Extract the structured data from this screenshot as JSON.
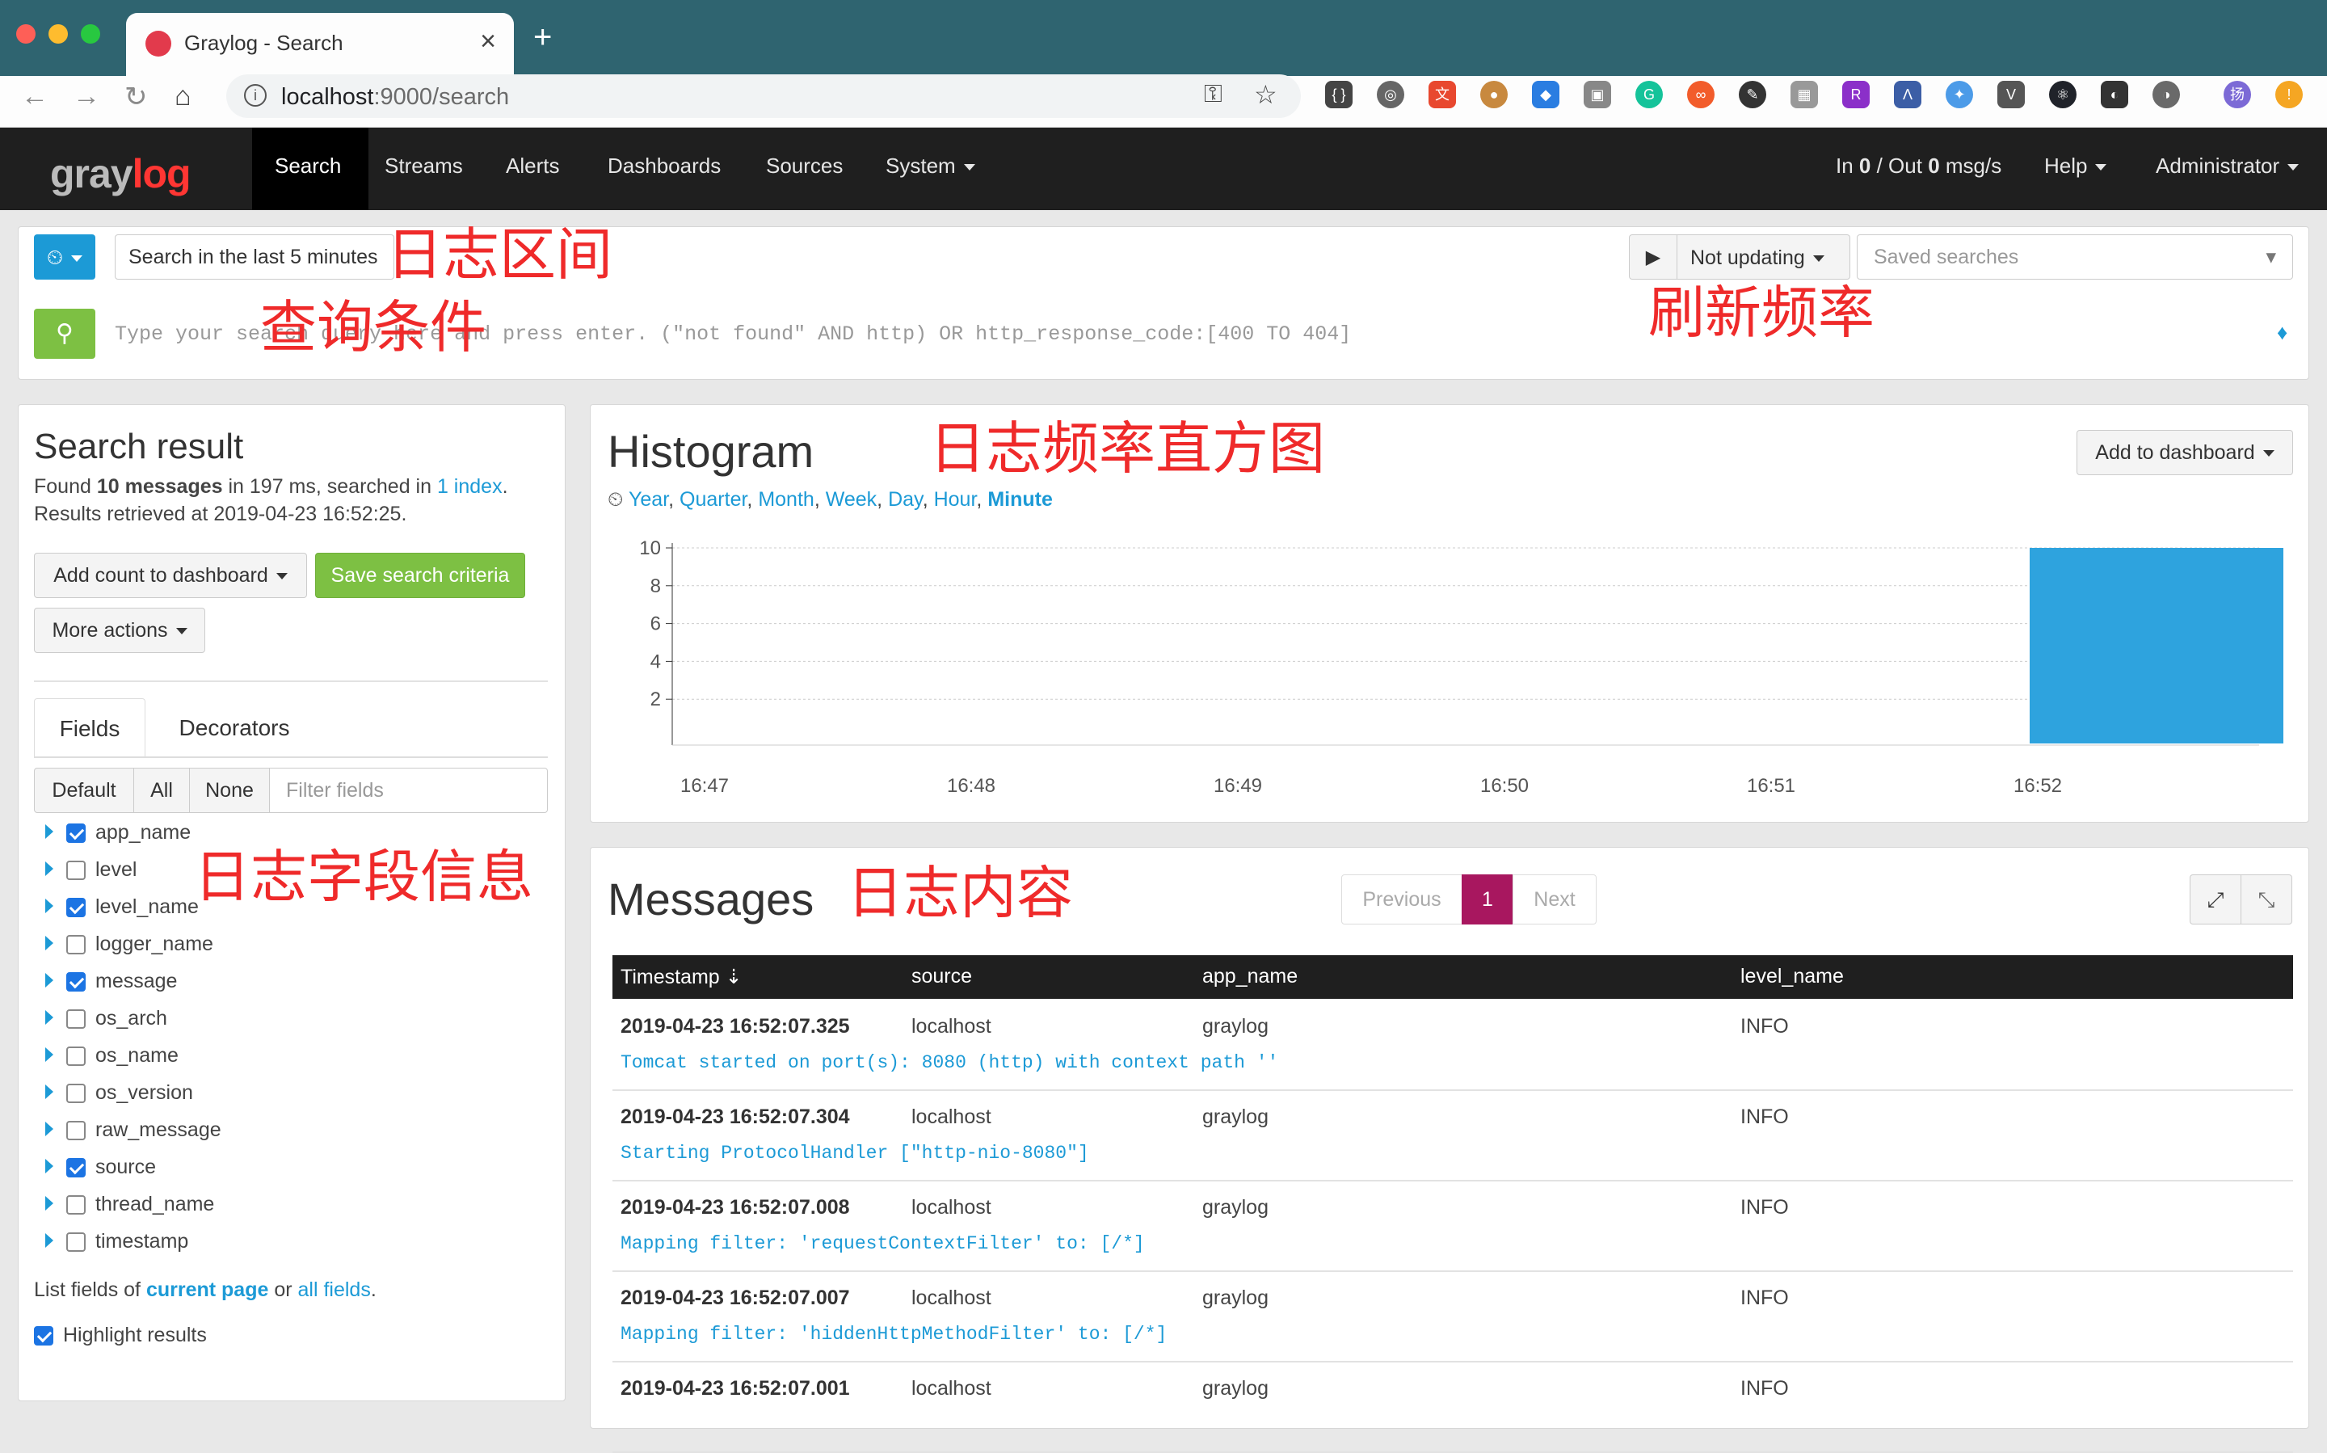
{
  "browser": {
    "tab_title": "Graylog - Search",
    "url_host": "localhost",
    "url_path": ":9000/search"
  },
  "nav": {
    "logo_gray": "gray",
    "logo_red": "log",
    "items": [
      "Search",
      "Streams",
      "Alerts",
      "Dashboards",
      "Sources",
      "System"
    ],
    "throughput_in_label": "In ",
    "throughput_in": "0",
    "throughput_sep": " / Out ",
    "throughput_out": "0",
    "throughput_unit": " msg/s",
    "help": "Help",
    "user": "Administrator"
  },
  "search_bar": {
    "range_text": "Search in the last 5 minutes",
    "query_placeholder": "Type your search query here and press enter. (\"not found\" AND http) OR http_response_code:[400 TO 404]",
    "refresh": "Not updating",
    "saved_searches": "Saved searches"
  },
  "annotations": {
    "range": "日志区间",
    "query": "查询条件",
    "refresh": "刷新频率",
    "histogram": "日志频率直方图",
    "fields": "日志字段信息",
    "messages": "日志内容"
  },
  "search_result": {
    "title": "Search result",
    "found_prefix": "Found ",
    "found_count": "10 messages",
    "found_mid": " in 197 ms, searched in ",
    "index_link": "1 index",
    "found_suffix": ".",
    "retrieved": "Results retrieved at 2019-04-23 16:52:25.",
    "add_count": "Add count to dashboard",
    "save_criteria": "Save search criteria",
    "more_actions": "More actions",
    "tab_fields": "Fields",
    "tab_decorators": "Decorators",
    "filter_default": "Default",
    "filter_all": "All",
    "filter_none": "None",
    "filter_placeholder": "Filter fields",
    "fields": [
      {
        "name": "app_name",
        "checked": true
      },
      {
        "name": "level",
        "checked": false
      },
      {
        "name": "level_name",
        "checked": true
      },
      {
        "name": "logger_name",
        "checked": false
      },
      {
        "name": "message",
        "checked": true
      },
      {
        "name": "os_arch",
        "checked": false
      },
      {
        "name": "os_name",
        "checked": false
      },
      {
        "name": "os_version",
        "checked": false
      },
      {
        "name": "raw_message",
        "checked": false
      },
      {
        "name": "source",
        "checked": true
      },
      {
        "name": "thread_name",
        "checked": false
      },
      {
        "name": "timestamp",
        "checked": false
      }
    ],
    "list_prefix": "List fields of ",
    "list_current": "current page",
    "list_or": " or ",
    "list_all": "all fields",
    "list_suffix": ".",
    "highlight": "Highlight results"
  },
  "histogram": {
    "title": "Histogram",
    "add_to_dashboard": "Add to dashboard",
    "resolutions": [
      "Year",
      "Quarter",
      "Month",
      "Week",
      "Day",
      "Hour",
      "Minute"
    ],
    "active_resolution": "Minute",
    "bar_color": "#2ea3de"
  },
  "chart_data": {
    "type": "bar",
    "categories": [
      "16:47",
      "16:48",
      "16:49",
      "16:50",
      "16:51",
      "16:52"
    ],
    "values": [
      0,
      0,
      0,
      0,
      0,
      10
    ],
    "title": "Histogram",
    "xlabel": "",
    "ylabel": "",
    "ylim": [
      0,
      10
    ],
    "yticks": [
      "10",
      "8",
      "6",
      "4",
      "2"
    ],
    "grid": true
  },
  "messages": {
    "title": "Messages",
    "prev": "Previous",
    "page": "1",
    "next": "Next",
    "columns": [
      "Timestamp",
      "source",
      "app_name",
      "level_name"
    ],
    "rows": [
      {
        "ts": "2019-04-23 16:52:07.325",
        "source": "localhost",
        "app": "graylog",
        "level": "INFO",
        "msg": "Tomcat started on port(s): 8080 (http) with context path ''"
      },
      {
        "ts": "2019-04-23 16:52:07.304",
        "source": "localhost",
        "app": "graylog",
        "level": "INFO",
        "msg": "Starting ProtocolHandler [\"http-nio-8080\"]"
      },
      {
        "ts": "2019-04-23 16:52:07.008",
        "source": "localhost",
        "app": "graylog",
        "level": "INFO",
        "msg": "Mapping filter: 'requestContextFilter' to: [/*]"
      },
      {
        "ts": "2019-04-23 16:52:07.007",
        "source": "localhost",
        "app": "graylog",
        "level": "INFO",
        "msg": "Mapping filter: 'hiddenHttpMethodFilter' to: [/*]"
      },
      {
        "ts": "2019-04-23 16:52:07.001",
        "source": "localhost",
        "app": "graylog",
        "level": "INFO",
        "msg": ""
      }
    ]
  }
}
